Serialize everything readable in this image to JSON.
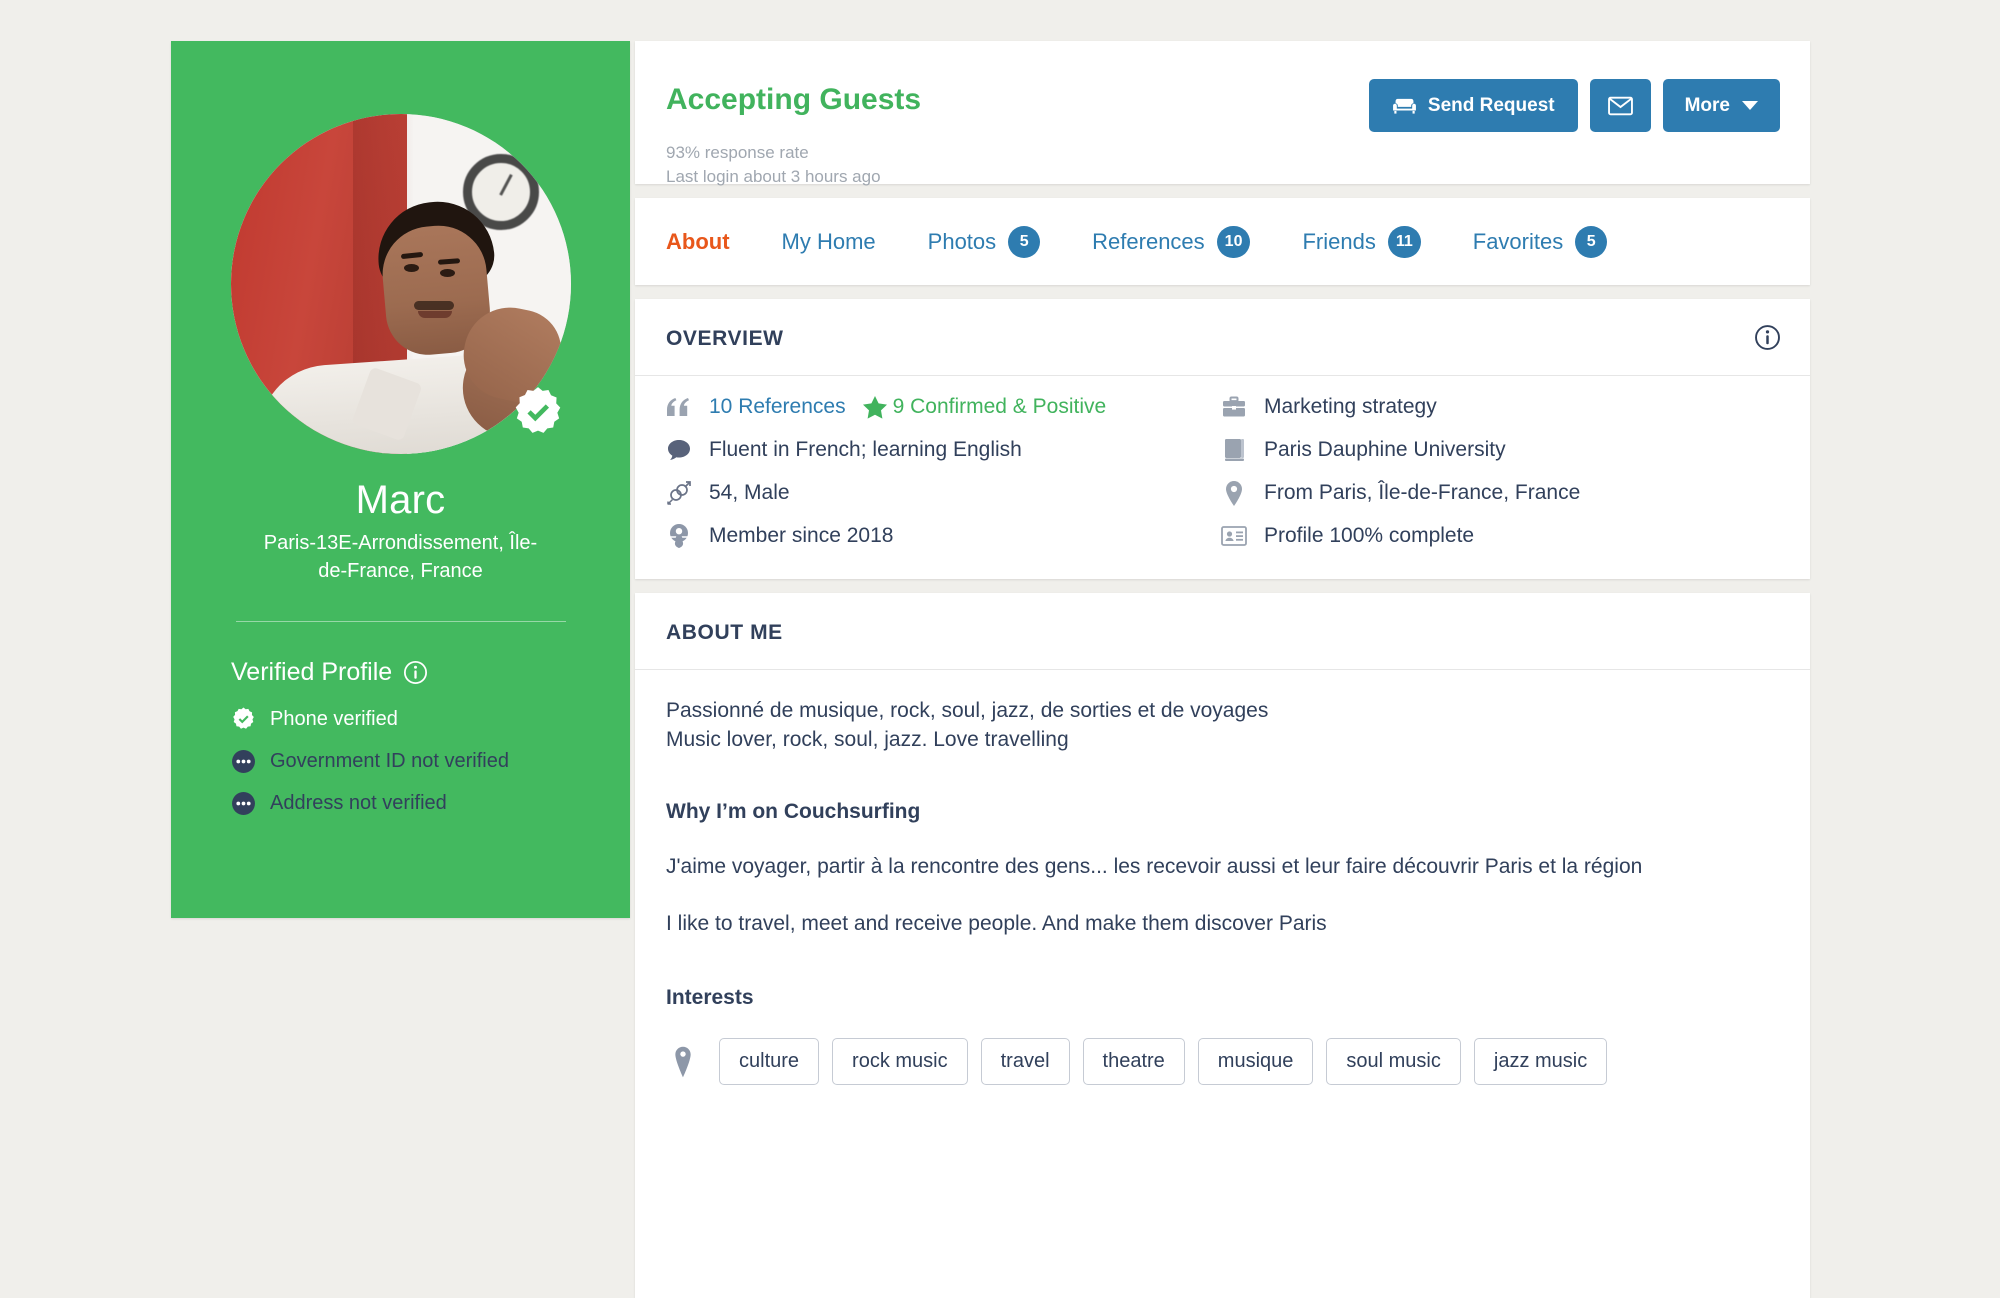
{
  "profile": {
    "name": "Marc",
    "location": "Paris-13E-Arrondissement, Île-de-France, France",
    "avatar_alt": "profile-photo",
    "verified_profile_label": "Verified Profile",
    "verifications": [
      {
        "label": "Phone verified",
        "state": "verified",
        "icon": "verified-badge-icon"
      },
      {
        "label": "Government ID not verified",
        "state": "unverified",
        "icon": "ellipsis-circle-icon"
      },
      {
        "label": "Address not verified",
        "state": "unverified",
        "icon": "ellipsis-circle-icon"
      }
    ],
    "colors": {
      "card_bg": "#43B95F",
      "text": "#FFFFFF",
      "unverified_text": "#32405C"
    }
  },
  "status": {
    "headline": "Accepting Guests",
    "response_rate": "93% response rate",
    "last_login": "Last login about 3 hours ago",
    "actions": {
      "send_request": "Send Request",
      "send_request_icon": "couch-icon",
      "message_icon": "envelope-icon",
      "more": "More",
      "more_icon": "chevron-down-icon"
    },
    "colors": {
      "headline": "#41B35D",
      "button": "#2E7CB0",
      "muted": "#A0A7B0"
    }
  },
  "tabs": {
    "items": [
      {
        "label": "About",
        "count": "",
        "active": true
      },
      {
        "label": "My Home",
        "count": "",
        "active": false
      },
      {
        "label": "Photos",
        "count": "5",
        "active": false
      },
      {
        "label": "References",
        "count": "10",
        "active": false
      },
      {
        "label": "Friends",
        "count": "11",
        "active": false
      },
      {
        "label": "Favorites",
        "count": "5",
        "active": false
      }
    ],
    "colors": {
      "active": "#E8571B",
      "inactive": "#2E7CB0",
      "badge": "#2E7CB0"
    }
  },
  "overview": {
    "title": "OVERVIEW",
    "info_icon": "info-circle-icon",
    "items": [
      {
        "icon": "quote-icon",
        "text": "10 References",
        "link": true,
        "extra": "9 Confirmed & Positive",
        "extra_icon": "star-icon",
        "extra_color": "#41B35D"
      },
      {
        "icon": "briefcase-icon",
        "text": "Marketing strategy"
      },
      {
        "icon": "speech-bubble-icon",
        "text": "Fluent in French; learning English"
      },
      {
        "icon": "book-icon",
        "text": "Paris Dauphine University"
      },
      {
        "icon": "gender-icon",
        "text": "54, Male"
      },
      {
        "icon": "map-pin-icon",
        "text": "From Paris, Île-de-France, France"
      },
      {
        "icon": "globe-icon",
        "text": "Member since 2018"
      },
      {
        "icon": "id-card-icon",
        "text": "Profile 100% complete"
      }
    ]
  },
  "about": {
    "title": "ABOUT ME",
    "intro_line1": "Passionné de musique, rock, soul, jazz, de sorties et de voyages",
    "intro_line2": "Music lover, rock, soul, jazz. Love travelling",
    "why_heading": "Why I’m on Couchsurfing",
    "why_fr": "J'aime voyager, partir à la rencontre des gens... les recevoir aussi et leur faire découvrir Paris et la région",
    "why_en": "I like to travel, meet and receive people. And make them discover Paris",
    "interests_heading": "Interests",
    "interests_icon": "tag-icon",
    "interests": [
      "culture",
      "rock music",
      "travel",
      "theatre",
      "musique",
      "soul music",
      "jazz music"
    ]
  }
}
